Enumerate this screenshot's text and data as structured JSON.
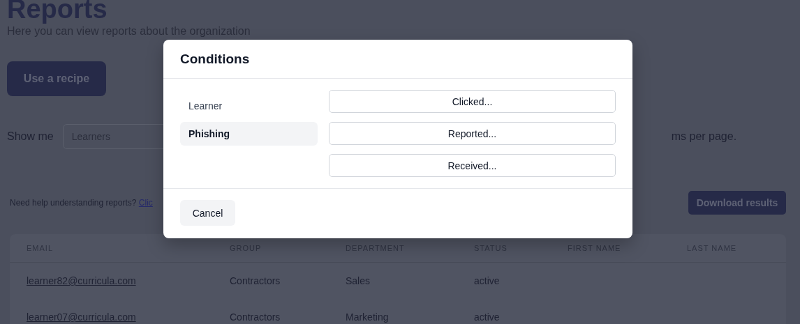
{
  "page": {
    "title": "Reports",
    "subtitle": "Here you can view reports about the organization",
    "recipe_button": "Use a recipe",
    "show_me_label": "Show me",
    "show_me_value": "Learners",
    "per_page_text": "ms per page.",
    "help_text": "Need help understanding reports?",
    "help_link": "Clic",
    "download_button": "Download results"
  },
  "table": {
    "columns": [
      "EMAIL",
      "GROUP",
      "DEPARTMENT",
      "STATUS",
      "FIRST NAME",
      "LAST NAME"
    ],
    "rows": [
      [
        "learner82@curricula.com",
        "Contractors",
        "Sales",
        "active",
        "",
        ""
      ],
      [
        "learner07@curricula.com",
        "Contractors",
        "Marketing",
        "active",
        "",
        ""
      ]
    ]
  },
  "modal": {
    "title": "Conditions",
    "categories": [
      {
        "label": "Learner",
        "selected": false
      },
      {
        "label": "Phishing",
        "selected": true
      }
    ],
    "options": [
      "Clicked...",
      "Reported...",
      "Received..."
    ],
    "cancel_button": "Cancel"
  }
}
